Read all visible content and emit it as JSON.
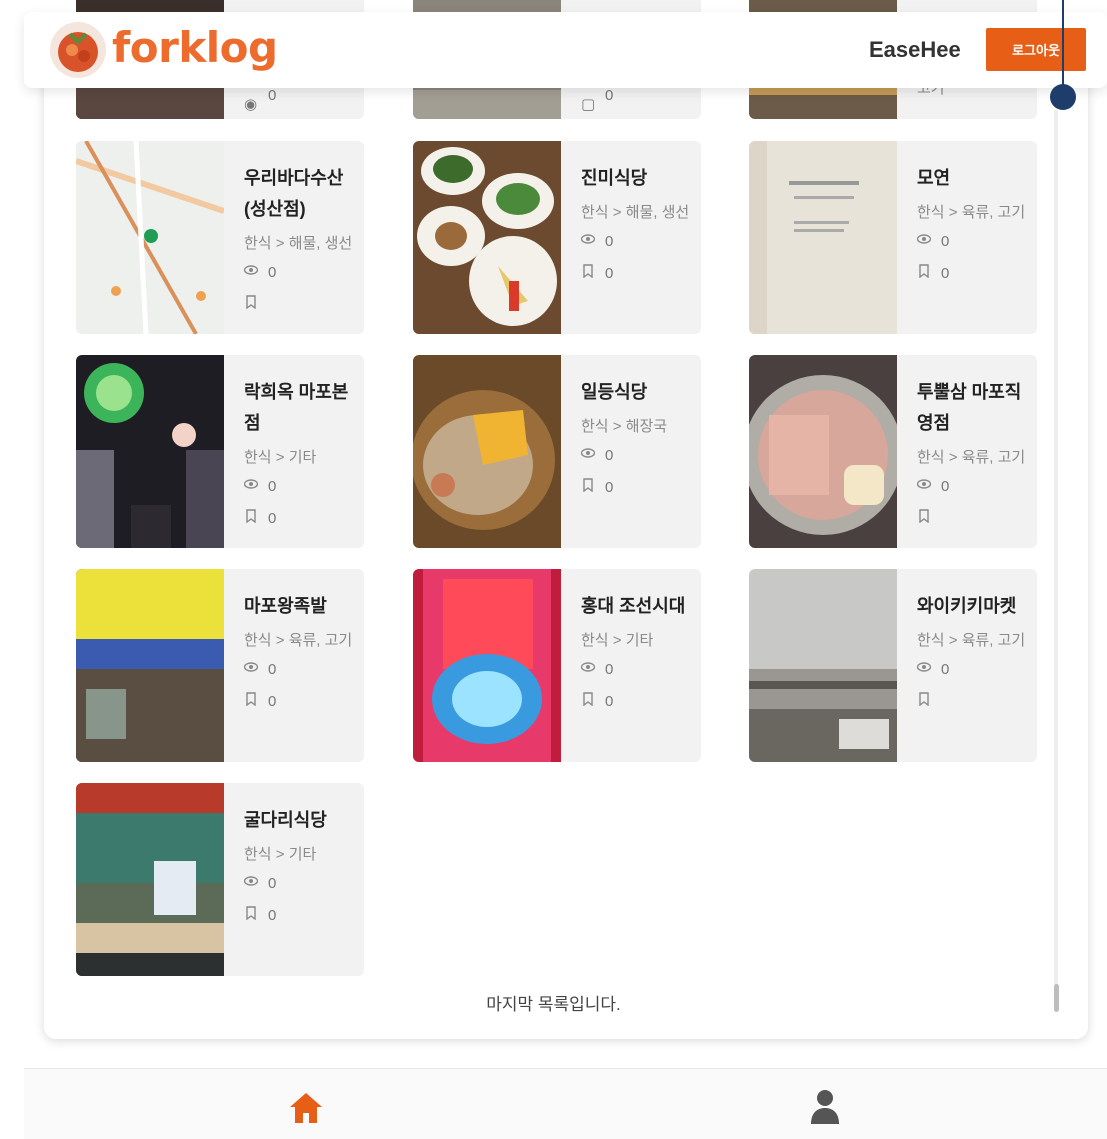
{
  "header": {
    "logo_text": "forklog",
    "username": "EaseHee",
    "logout_label": "로그아웃"
  },
  "colors": {
    "accent": "#e75f17",
    "scroll": "#1f3d6b"
  },
  "top_partial": [
    {
      "stat": "0"
    },
    {
      "stat": "0"
    },
    {
      "stat": "고기"
    }
  ],
  "cards": [
    {
      "name": "우리바다수산(성산점)",
      "category": "한식 > 해물, 생선",
      "views": "0",
      "bookmarks": "",
      "thumb_icon": "map-thumbnail"
    },
    {
      "name": "진미식당",
      "category": "한식 > 해물, 생선",
      "views": "0",
      "bookmarks": "0",
      "thumb_icon": "side-dishes-photo"
    },
    {
      "name": "모연",
      "category": "한식 > 육류, 고기",
      "views": "0",
      "bookmarks": "0",
      "thumb_icon": "menu-board-photo"
    },
    {
      "name": "락희옥 마포본점",
      "category": "한식 > 기타",
      "views": "0",
      "bookmarks": "0",
      "thumb_icon": "alley-photo"
    },
    {
      "name": "일등식당",
      "category": "한식 > 해장국",
      "views": "0",
      "bookmarks": "0",
      "thumb_icon": "soup-photo"
    },
    {
      "name": "투뿔삼 마포직영점",
      "category": "한식 > 육류, 고기",
      "views": "0",
      "bookmarks": "",
      "thumb_icon": "grill-photo"
    },
    {
      "name": "마포왕족발",
      "category": "한식 > 육류, 고기",
      "views": "0",
      "bookmarks": "0",
      "thumb_icon": "storefront-photo"
    },
    {
      "name": "홍대 조선시대",
      "category": "한식 > 기타",
      "views": "0",
      "bookmarks": "0",
      "thumb_icon": "neon-sign-photo"
    },
    {
      "name": "와이키키마켓",
      "category": "한식 > 육류, 고기",
      "views": "0",
      "bookmarks": "",
      "thumb_icon": "riverside-photo"
    },
    {
      "name": "굴다리식당",
      "category": "한식 > 기타",
      "views": "0",
      "bookmarks": "0",
      "thumb_icon": "restaurant-front-photo"
    }
  ],
  "footer_text": "마지막 목록입니다.",
  "bottom_nav": {
    "home_icon": "home-icon",
    "user_icon": "user-icon"
  }
}
